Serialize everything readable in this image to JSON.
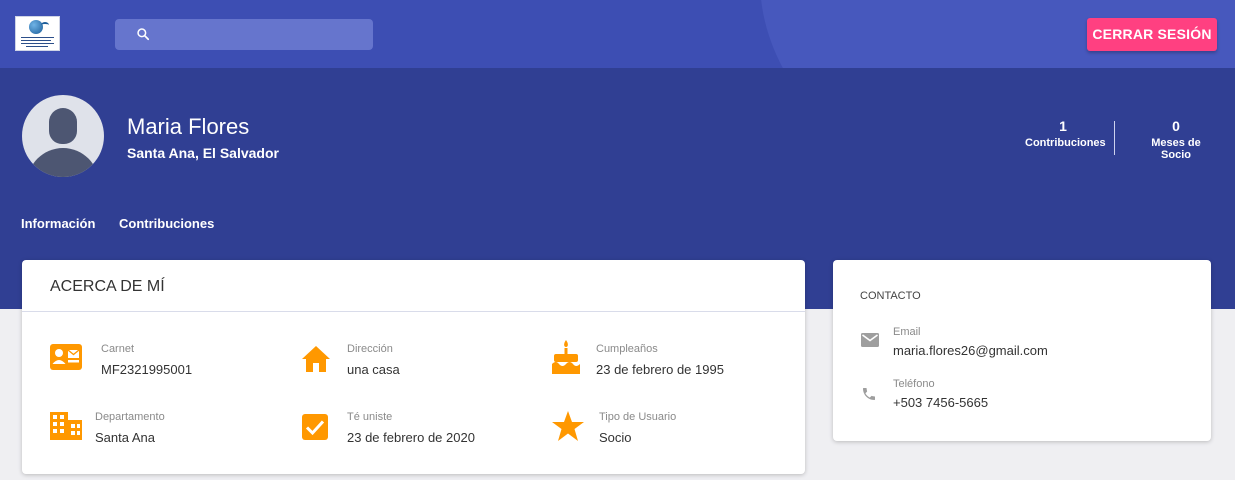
{
  "colors": {
    "app_bar": "#3d4eb3",
    "profile_header": "#303f93",
    "accent_button": "#ff4081",
    "icon_orange": "#ff9800",
    "icon_gray": "#9e9e9e"
  },
  "topbar": {
    "logo_icon": "organization-logo",
    "search_icon": "search-icon",
    "search_placeholder": "",
    "logout_label": "CERRAR SESIÓN"
  },
  "profile": {
    "avatar_icon": "user-avatar-placeholder",
    "name": "Maria Flores",
    "location": "Santa Ana, El Salvador",
    "stats": [
      {
        "value": "1",
        "label": "Contribuciones"
      },
      {
        "value": "0",
        "label": "Meses de Socio"
      }
    ],
    "tabs": [
      {
        "label": "Información"
      },
      {
        "label": "Contribuciones"
      }
    ]
  },
  "about": {
    "title": "ACERCA DE MÍ",
    "items": [
      {
        "icon": "id-card-icon",
        "label": "Carnet",
        "value": "MF2321995001"
      },
      {
        "icon": "home-icon",
        "label": "Dirección",
        "value": "una casa"
      },
      {
        "icon": "cake-icon",
        "label": "Cumpleaños",
        "value": "23 de febrero de 1995"
      },
      {
        "icon": "building-icon",
        "label": "Departamento",
        "value": "Santa Ana"
      },
      {
        "icon": "checkbox-icon",
        "label": "Té uniste",
        "value": "23 de febrero de 2020"
      },
      {
        "icon": "star-icon",
        "label": "Tipo de Usuario",
        "value": "Socio"
      }
    ]
  },
  "contact": {
    "title": "CONTACTO",
    "items": [
      {
        "icon": "email-icon",
        "label": "Email",
        "value": "maria.flores26@gmail.com"
      },
      {
        "icon": "phone-icon",
        "label": "Teléfono",
        "value": "+503 7456-5665"
      }
    ]
  }
}
